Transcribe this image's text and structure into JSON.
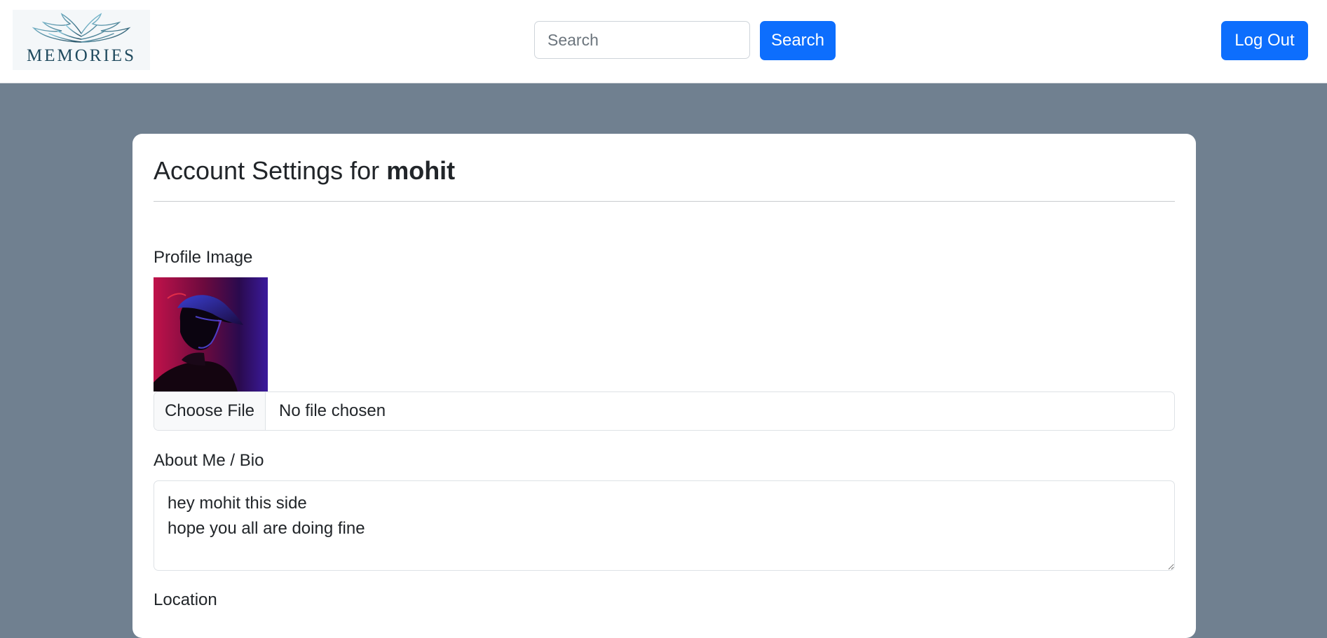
{
  "navbar": {
    "logo_text": "MEMORIES",
    "search_placeholder": "Search",
    "search_button": "Search",
    "logout_button": "Log Out"
  },
  "settings": {
    "title_prefix": "Account Settings for",
    "username": "mohit",
    "profile_image_label": "Profile Image",
    "file_button": "Choose File",
    "file_status": "No file chosen",
    "bio_label": "About Me / Bio",
    "bio_value": "hey mohit this side\nhope you all are doing fine",
    "location_label": "Location"
  },
  "colors": {
    "primary": "#0d6efd",
    "page_background": "#708090",
    "card_background": "#ffffff"
  }
}
